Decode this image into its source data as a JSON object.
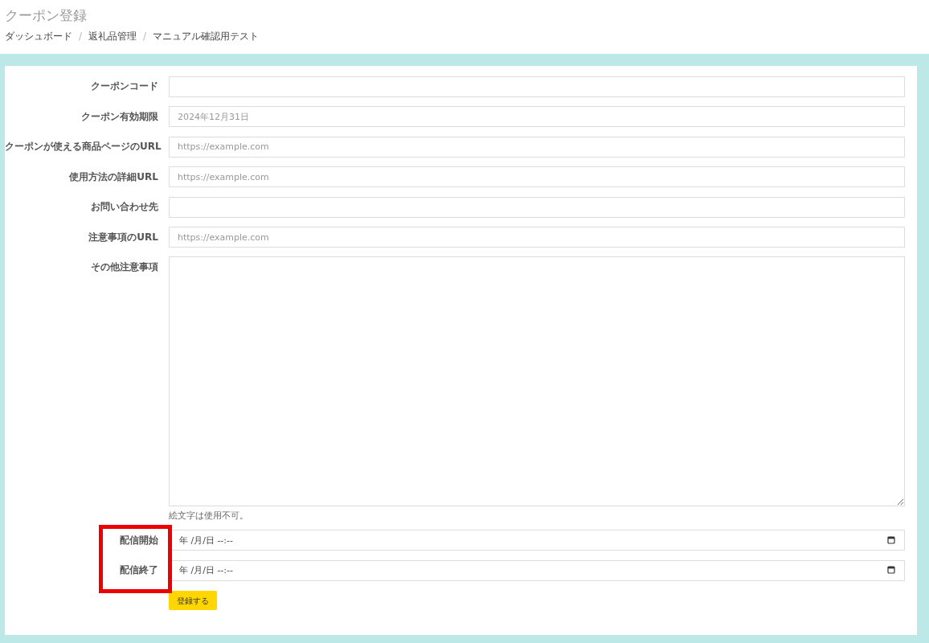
{
  "page": {
    "title": "クーポン登録",
    "breadcrumbs": [
      "ダッシュボード",
      "返礼品管理",
      "マニュアル確認用テスト"
    ],
    "separator": "/"
  },
  "form": {
    "fields": [
      {
        "kind": "text",
        "label": "クーポンコード",
        "highlighted": false
      },
      {
        "kind": "text",
        "label": "クーポン有効期限",
        "placeholder": "2024年12月31日",
        "highlighted": false
      },
      {
        "kind": "text",
        "label": "クーポンが使える商品ページのURL",
        "placeholder": "https://example.com",
        "highlighted": false
      },
      {
        "kind": "text",
        "label": "使用方法の詳細URL",
        "placeholder": "https://example.com",
        "highlighted": false
      },
      {
        "kind": "text",
        "label": "お問い合わせ先",
        "highlighted": false
      },
      {
        "kind": "text",
        "label": "注意事項のURL",
        "placeholder": "https://example.com",
        "highlighted": false
      },
      {
        "kind": "textarea",
        "label": "その他注意事項",
        "hint": "絵文字は使用不可。",
        "highlighted": false
      },
      {
        "kind": "datetime",
        "label": "配信開始",
        "placeholder": "年 /月/日 --:--",
        "highlighted": true
      },
      {
        "kind": "datetime",
        "label": "配信終了",
        "placeholder": "年 /月/日 --:--",
        "highlighted": true
      }
    ],
    "submit": "登録する"
  }
}
